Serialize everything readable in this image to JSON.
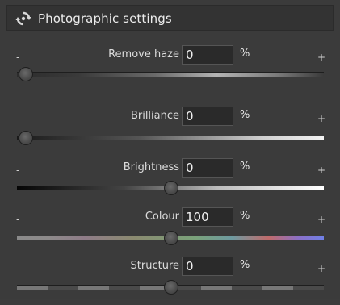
{
  "panel": {
    "title": "Photographic settings",
    "icon": "reset-arrows-icon"
  },
  "sliders": [
    {
      "id": "haze",
      "label": "Remove haze",
      "value": "0",
      "unit": "%",
      "minus": "-",
      "plus": "+",
      "position_fraction": 0.0
    },
    {
      "id": "brilliance",
      "label": "Brilliance",
      "value": "0",
      "unit": "%",
      "minus": "-",
      "plus": "+",
      "position_fraction": 0.0
    },
    {
      "id": "brightness",
      "label": "Brightness",
      "value": "0",
      "unit": "%",
      "minus": "-",
      "plus": "+",
      "position_fraction": 0.5
    },
    {
      "id": "colour",
      "label": "Colour",
      "value": "100",
      "unit": "%",
      "minus": "-",
      "plus": "+",
      "position_fraction": 0.5
    },
    {
      "id": "structure",
      "label": "Structure",
      "value": "0",
      "unit": "%",
      "minus": "-",
      "plus": "+",
      "position_fraction": 0.5
    }
  ],
  "colors": {
    "background": "#3b3b3b",
    "header": "#333333",
    "text": "#e6e6e6"
  }
}
